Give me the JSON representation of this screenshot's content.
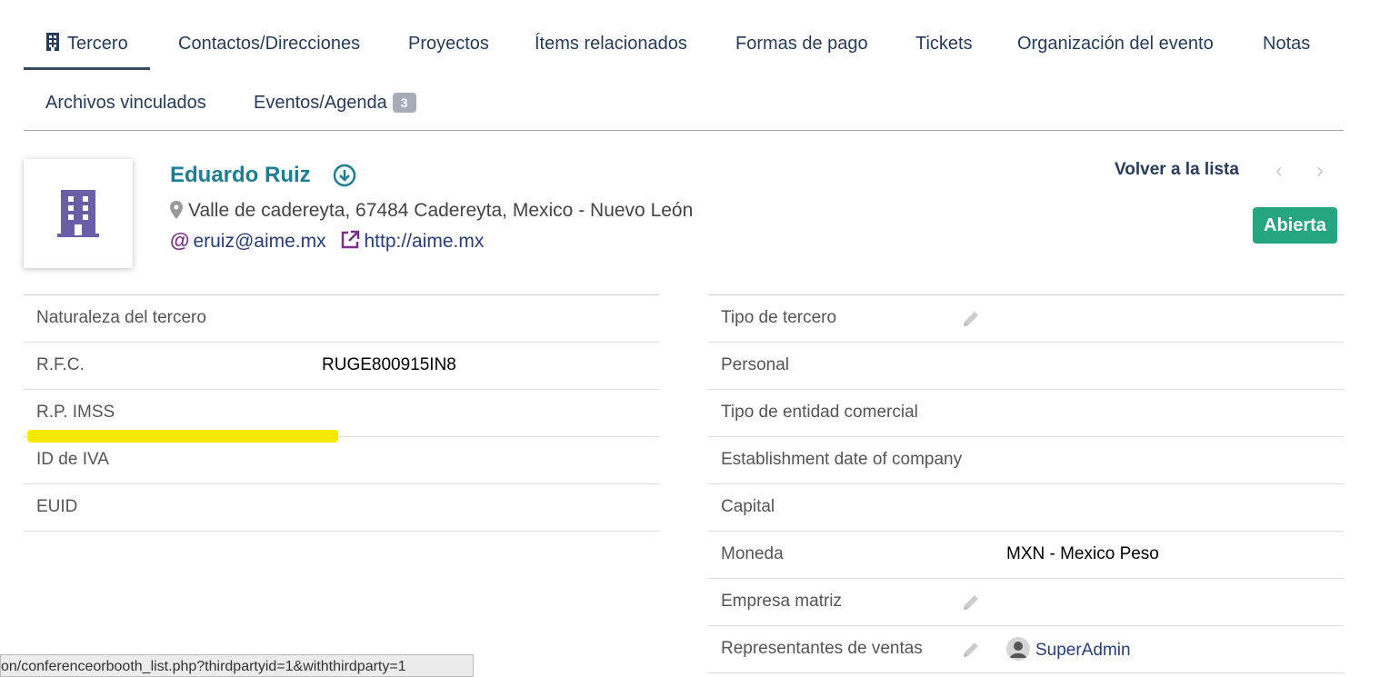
{
  "tabs": [
    {
      "label": "Tercero",
      "active": true
    },
    {
      "label": "Contactos/Direcciones"
    },
    {
      "label": "Proyectos"
    },
    {
      "label": "Ítems relacionados"
    },
    {
      "label": "Formas de pago"
    },
    {
      "label": "Tickets"
    },
    {
      "label": "Organización del evento"
    },
    {
      "label": "Notas"
    },
    {
      "label": "Archivos vinculados"
    },
    {
      "label": "Eventos/Agenda",
      "badge": "3"
    }
  ],
  "header": {
    "name": "Eduardo Ruiz",
    "address": "Valle de cadereyta, 67484 Cadereyta, Mexico - Nuevo León",
    "email": "eruiz@aime.mx",
    "website": "http://aime.mx",
    "back_link": "Volver a la lista",
    "prev_arrow": "‹",
    "next_arrow": "›",
    "status": "Abierta"
  },
  "left_table": [
    {
      "label": "Naturaleza del tercero",
      "value": ""
    },
    {
      "label": "R.F.C.",
      "value": "RUGE800915IN8"
    },
    {
      "label": "R.P. IMSS",
      "value": ""
    },
    {
      "label": "ID de IVA",
      "value": ""
    },
    {
      "label": "EUID",
      "value": ""
    }
  ],
  "right_table": [
    {
      "label": "Tipo de tercero",
      "value": "",
      "editable": true
    },
    {
      "label": "Personal",
      "value": ""
    },
    {
      "label": "Tipo de entidad comercial",
      "value": ""
    },
    {
      "label": "Establishment date of company",
      "value": ""
    },
    {
      "label": "Capital",
      "value": ""
    },
    {
      "label": "Moneda",
      "value": "MXN - Mexico Peso"
    },
    {
      "label": "Empresa matriz",
      "value": "",
      "editable": true
    },
    {
      "label": "Representantes de ventas",
      "value": "SuperAdmin",
      "editable": true
    }
  ],
  "statusbar": {
    "url": "on/conferenceorbooth_list.php?thirdpartyid=1&withthirdparty=1"
  },
  "colors": {
    "accent": "#1c7e93",
    "nav_text": "#263c5c",
    "status_bg": "#25a580",
    "highlight": "#f7e800",
    "icon_purple": "#6b5ea8"
  }
}
